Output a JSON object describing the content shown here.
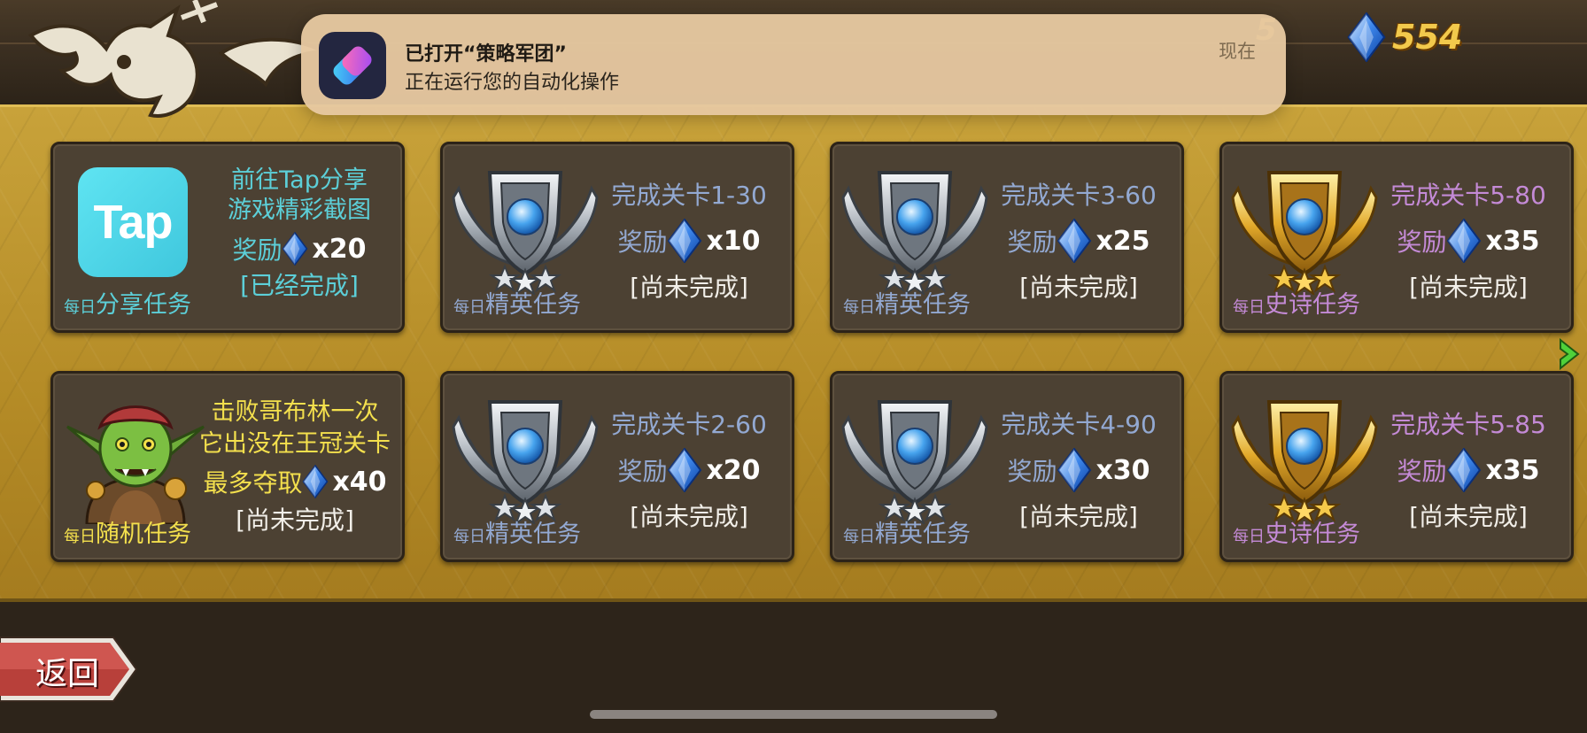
{
  "notification": {
    "title": "已打开“策略军团”",
    "body": "正在运行您的自动化操作",
    "time": "现在",
    "app_icon": "shortcuts-icon"
  },
  "header": {
    "gem_count": "554",
    "obscured_value": "5"
  },
  "missions": [
    {
      "type": "share",
      "badge_prefix": "每日",
      "badge_label": "分享任务",
      "goal_line1": "前往Tap分享",
      "goal_line2": "游戏精彩截图",
      "reward_label": "奖励",
      "reward_count": "x20",
      "status": "[已经完成]",
      "icon": "tap-logo",
      "icon_text": "Tap",
      "color": "#5ccfd8"
    },
    {
      "type": "elite",
      "badge_prefix": "每日",
      "badge_label": "精英任务",
      "goal_line1": "完成关卡1-30",
      "reward_label": "奖励",
      "reward_count": "x10",
      "status": "[尚未完成]",
      "icon": "silver-wing-shield-icon",
      "color": "#93a9d2"
    },
    {
      "type": "elite",
      "badge_prefix": "每日",
      "badge_label": "精英任务",
      "goal_line1": "完成关卡3-60",
      "reward_label": "奖励",
      "reward_count": "x25",
      "status": "[尚未完成]",
      "icon": "silver-wing-shield-icon",
      "color": "#93a9d2"
    },
    {
      "type": "epic",
      "badge_prefix": "每日",
      "badge_label": "史诗任务",
      "goal_line1": "完成关卡5-80",
      "reward_label": "奖励",
      "reward_count": "x35",
      "status": "[尚未完成]",
      "icon": "gold-wing-shield-icon",
      "color": "#c48ad6"
    },
    {
      "type": "random",
      "badge_prefix": "每日",
      "badge_label": "随机任务",
      "goal_line1": "击败哥布林一次",
      "goal_line2": "它出没在王冠关卡",
      "reward_label": "最多夺取",
      "reward_count": "x40",
      "status": "[尚未完成]",
      "icon": "goblin-portrait-icon",
      "color": "#f4e04d"
    },
    {
      "type": "elite",
      "badge_prefix": "每日",
      "badge_label": "精英任务",
      "goal_line1": "完成关卡2-60",
      "reward_label": "奖励",
      "reward_count": "x20",
      "status": "[尚未完成]",
      "icon": "silver-wing-shield-icon",
      "color": "#93a9d2"
    },
    {
      "type": "elite",
      "badge_prefix": "每日",
      "badge_label": "精英任务",
      "goal_line1": "完成关卡4-90",
      "reward_label": "奖励",
      "reward_count": "x30",
      "status": "[尚未完成]",
      "icon": "silver-wing-shield-icon",
      "color": "#93a9d2"
    },
    {
      "type": "epic",
      "badge_prefix": "每日",
      "badge_label": "史诗任务",
      "goal_line1": "完成关卡5-85",
      "reward_label": "奖励",
      "reward_count": "x35",
      "status": "[尚未完成]",
      "icon": "gold-wing-shield-icon",
      "color": "#c48ad6"
    }
  ],
  "navigation": {
    "back_label": "返回",
    "next_icon": "chevron-right-icon"
  }
}
